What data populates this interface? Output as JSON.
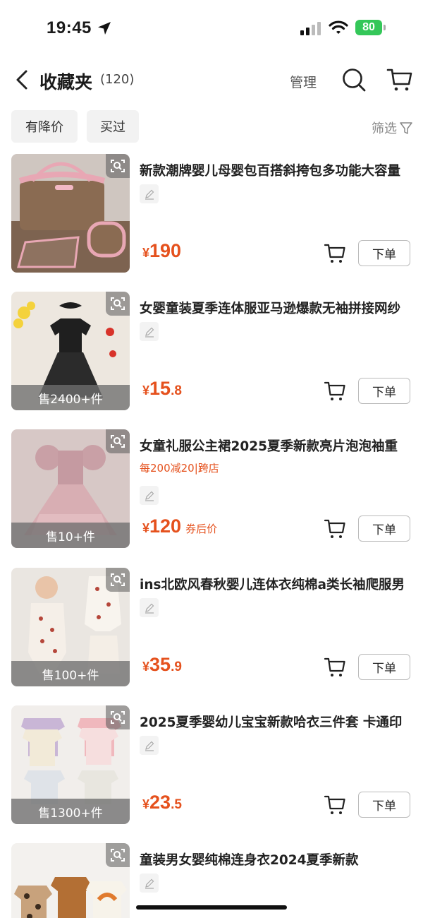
{
  "status_bar": {
    "time": "19:45",
    "battery": "80"
  },
  "nav": {
    "title": "收藏夹",
    "count": "(120)",
    "manage": "管理"
  },
  "filters": {
    "chips": [
      "有降价",
      "买过"
    ],
    "filter_label": "筛选"
  },
  "items": [
    {
      "name": "新款潮牌婴儿母婴包百搭斜挎包多功能大容量",
      "sold": "",
      "promo": "",
      "price_int": "190",
      "price_dec": "",
      "price_suffix": "",
      "order_label": "下单"
    },
    {
      "name": "女婴童装夏季连体服亚马逊爆款无袖拼接网纱",
      "sold": "售2400+件",
      "promo": "",
      "price_int": "15",
      "price_dec": ".8",
      "price_suffix": "",
      "order_label": "下单"
    },
    {
      "name": "女童礼服公主裙2025夏季新款亮片泡泡袖重",
      "sold": "售10+件",
      "promo": "每200减20|跨店",
      "price_int": "120",
      "price_dec": "",
      "price_suffix": "券后价",
      "order_label": "下单"
    },
    {
      "name": "ins北欧风春秋婴儿连体衣纯棉a类长袖爬服男",
      "sold": "售100+件",
      "promo": "",
      "price_int": "35",
      "price_dec": ".9",
      "price_suffix": "",
      "order_label": "下单"
    },
    {
      "name": "2025夏季婴幼儿宝宝新款哈衣三件套 卡通印",
      "sold": "售1300+件",
      "promo": "",
      "price_int": "23",
      "price_dec": ".5",
      "price_suffix": "",
      "order_label": "下单"
    },
    {
      "name": "童装男女婴纯棉连身衣2024夏季新款",
      "sold": "",
      "promo": "",
      "price_int": "",
      "price_dec": "",
      "price_suffix": "",
      "order_label": ""
    }
  ],
  "currency_symbol": "¥",
  "colors": {
    "accent": "#e5511d",
    "battery": "#34c759"
  }
}
